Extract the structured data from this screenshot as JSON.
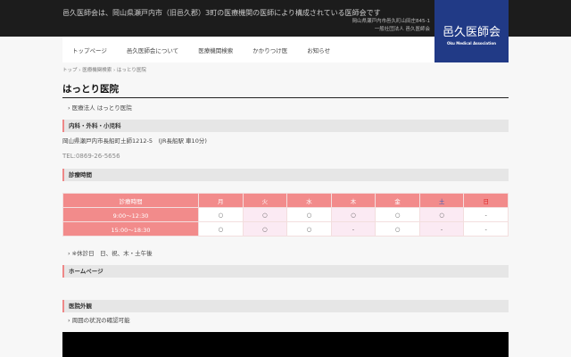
{
  "header": {
    "tagline": "邑久医師会は、岡山県瀬戸内市（旧邑久郡）3町の医療機関の医師により構成されている医師会です",
    "address": "岡山県瀬戸内市邑久町山田庄845-1",
    "org": "一般社団法人 邑久医師会",
    "logo_jp": "邑久医師会",
    "logo_en": "Oku Medical Association"
  },
  "nav": [
    "トップページ",
    "邑久医師会について",
    "医療機関検索",
    "かかりつけ医",
    "お知らせ"
  ],
  "breadcrumb": "トップ › 医療機関検索 › はっとり医院",
  "title": "はっとり医院",
  "corp": "医療法人 はっとり医院",
  "departments": "内科・外科・小児科",
  "address": "岡山県瀬戸内市長船町土師1212-5　(JR長船駅 車10分)",
  "tel": "TEL:0869-26-5656",
  "hours_heading": "診療時間",
  "table": {
    "header": [
      "診療時間",
      "月",
      "火",
      "水",
      "木",
      "金",
      "土",
      "日"
    ],
    "rows": [
      [
        "9:00〜12:30",
        "○",
        "○",
        "○",
        "○",
        "○",
        "○",
        "-"
      ],
      [
        "15:00〜18:30",
        "○",
        "○",
        "○",
        "-",
        "○",
        "-",
        "-"
      ]
    ]
  },
  "note": "※休診日　日、祝、木・土午後",
  "homepage_heading": "ホームページ",
  "exterior_heading": "医院外観",
  "exterior_item": "周囲の状況の確認可能",
  "colors": {
    "accent": "#f28b8b",
    "logo": "#213a86"
  }
}
